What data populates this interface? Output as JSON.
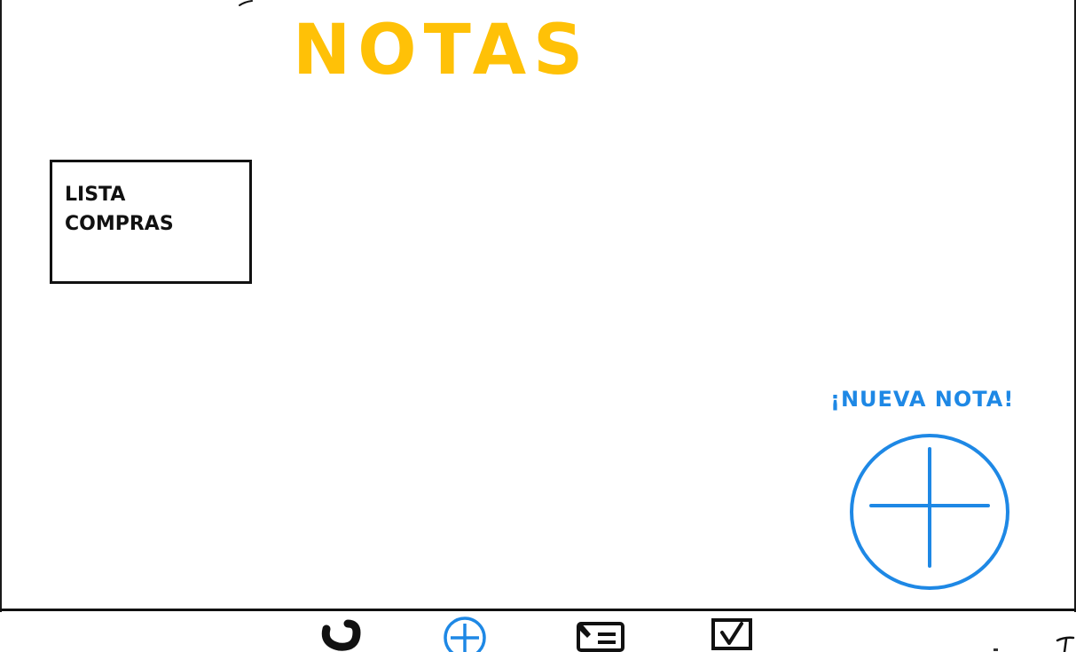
{
  "header": {
    "title": "NOTAS"
  },
  "notes": [
    {
      "title": "LISTA\nCOMPRAS"
    }
  ],
  "new_note": {
    "label": "¡NUEVA NOTA!"
  },
  "bottom_nav": {
    "items": [
      {
        "icon": "back-arrow-icon"
      },
      {
        "icon": "add-circle-icon"
      },
      {
        "icon": "notes-list-icon"
      },
      {
        "icon": "checkbox-icon"
      }
    ]
  },
  "colors": {
    "title": "#FFC107",
    "accent_blue": "#1E88E5",
    "ink": "#111111"
  }
}
